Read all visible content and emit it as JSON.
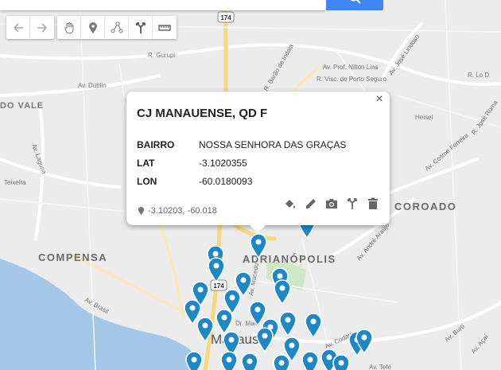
{
  "map": {
    "labels": {
      "compensa": "COMPENSA",
      "coroado": "COROADO",
      "adrianopolis": "ADRIANÓPOLIS",
      "dovale": "DO VALE",
      "manaus": "Manaus",
      "hw174a": "174",
      "hw174b": "174",
      "gurupi": "R. Gurupi",
      "dublin": "Av. Dublin",
      "laguna": "Av. Laguna",
      "teixeira": "Teixeira",
      "nilton": "Av. Prof. Nilton Lins",
      "visc": "R. Visc. de Porto Seguro",
      "lindoso": "Av. José Lindoso",
      "lo": "R. Lo D",
      "heisel": "Heisel",
      "cosme": "Av. Cosme Ferreira",
      "jose": "R. José Roma",
      "brasil": "Av. Brasil",
      "andre": "Av. André Araújo",
      "macedo": "Av. Macedo",
      "maia": "Dr. Maia",
      "codajas": "Av. Codajás",
      "burti": "Av. Burti",
      "acai": "Av. Açaí",
      "tefe": "Av. Tefé",
      "barao": "R. Barão de Indaiá"
    }
  },
  "toolbar": {
    "undo": "undo-icon",
    "redo": "redo-icon",
    "hand": "hand-icon",
    "marker": "marker-icon",
    "line": "draw-line-icon",
    "route": "route-icon",
    "ruler": "ruler-icon"
  },
  "popup": {
    "title": "CJ MANAUENSE, QD F",
    "close": "×",
    "rows": [
      {
        "key": "BAIRRO",
        "value": "NOSSA SENHORA DAS GRAÇAS"
      },
      {
        "key": "LAT",
        "value": "-3.1020355"
      },
      {
        "key": "LON",
        "value": "-60.0180093"
      }
    ],
    "coords": "-3.10203, -60.018"
  },
  "colors": {
    "accent": "#4285f4",
    "pin": "#1e88c7"
  }
}
